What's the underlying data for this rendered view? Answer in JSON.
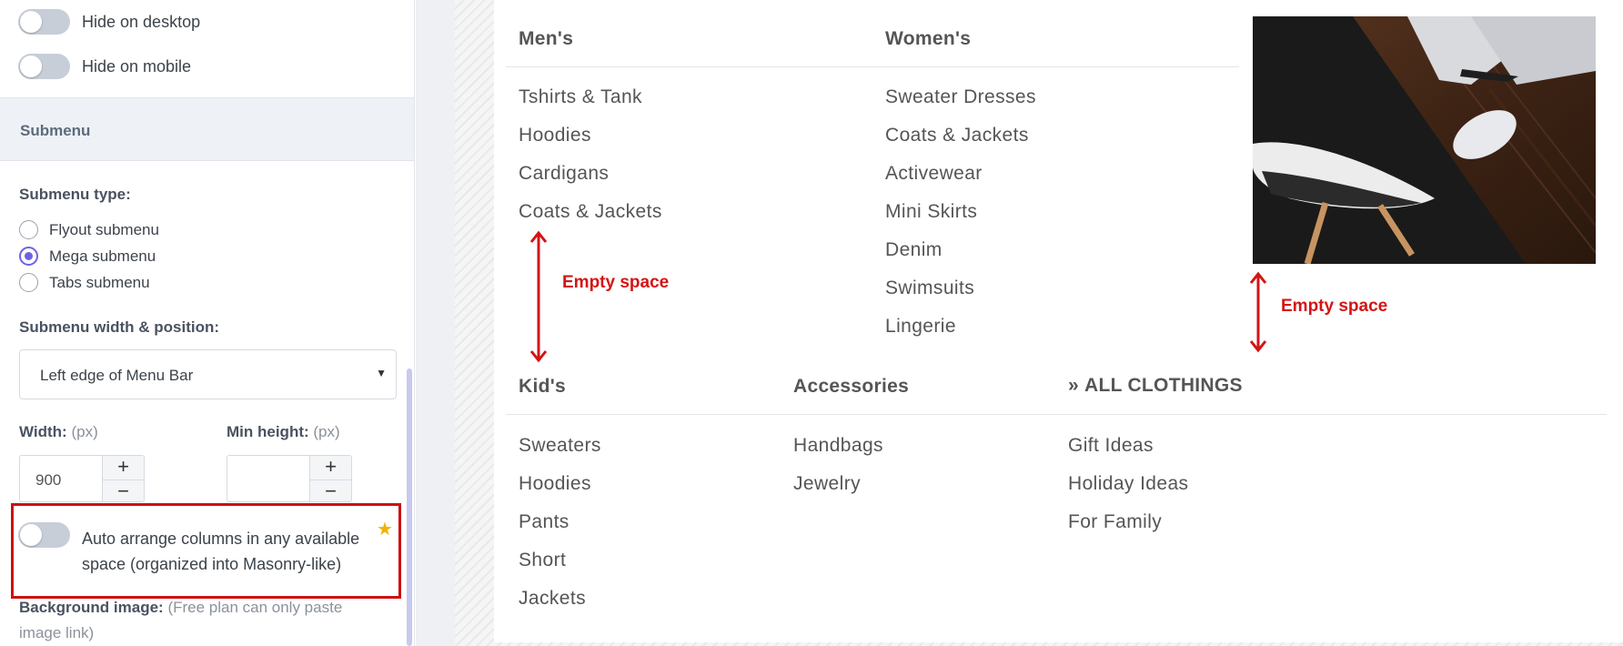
{
  "settings": {
    "hide_desktop_label": "Hide on desktop",
    "hide_mobile_label": "Hide on mobile",
    "section_title": "Submenu",
    "submenu_type_label": "Submenu type:",
    "submenu_types": [
      {
        "label": "Flyout submenu",
        "checked": false
      },
      {
        "label": "Mega submenu",
        "checked": true
      },
      {
        "label": "Tabs submenu",
        "checked": false
      }
    ],
    "width_position_label": "Submenu width & position:",
    "width_position_value": "Left edge of Menu Bar",
    "width_label": "Width:",
    "width_unit": "(px)",
    "width_value": "900",
    "min_height_label": "Min height:",
    "min_height_unit": "(px)",
    "min_height_value": "",
    "plus": "+",
    "minus": "−",
    "auto_arrange_label": "Auto arrange columns in any available space (organized into Masonry-like)",
    "bg_image_label": "Background image:",
    "bg_image_note": "(Free plan can only paste image link)"
  },
  "megamenu": {
    "columns_top": [
      {
        "title": "Men's",
        "items": [
          "Tshirts & Tank",
          "Hoodies",
          "Cardigans",
          "Coats & Jackets"
        ]
      },
      {
        "title": "Women's",
        "items": [
          "Sweater Dresses",
          "Coats & Jackets",
          "Activewear",
          "Mini Skirts",
          "Denim",
          "Swimsuits",
          "Lingerie"
        ]
      }
    ],
    "columns_bottom": [
      {
        "title": "Kid's",
        "items": [
          "Sweaters",
          "Hoodies",
          "Pants",
          "Short",
          "Jackets"
        ]
      },
      {
        "title": "Accessories",
        "items": [
          "Handbags",
          "Jewelry"
        ]
      },
      {
        "title": "ALL CLOTHINGS",
        "items": [
          "Gift Ideas",
          "Holiday Ideas",
          "For Family"
        ]
      }
    ]
  },
  "annotations": {
    "empty_space_1": "Empty space",
    "empty_space_2": "Empty space",
    "color": "#d41414"
  }
}
